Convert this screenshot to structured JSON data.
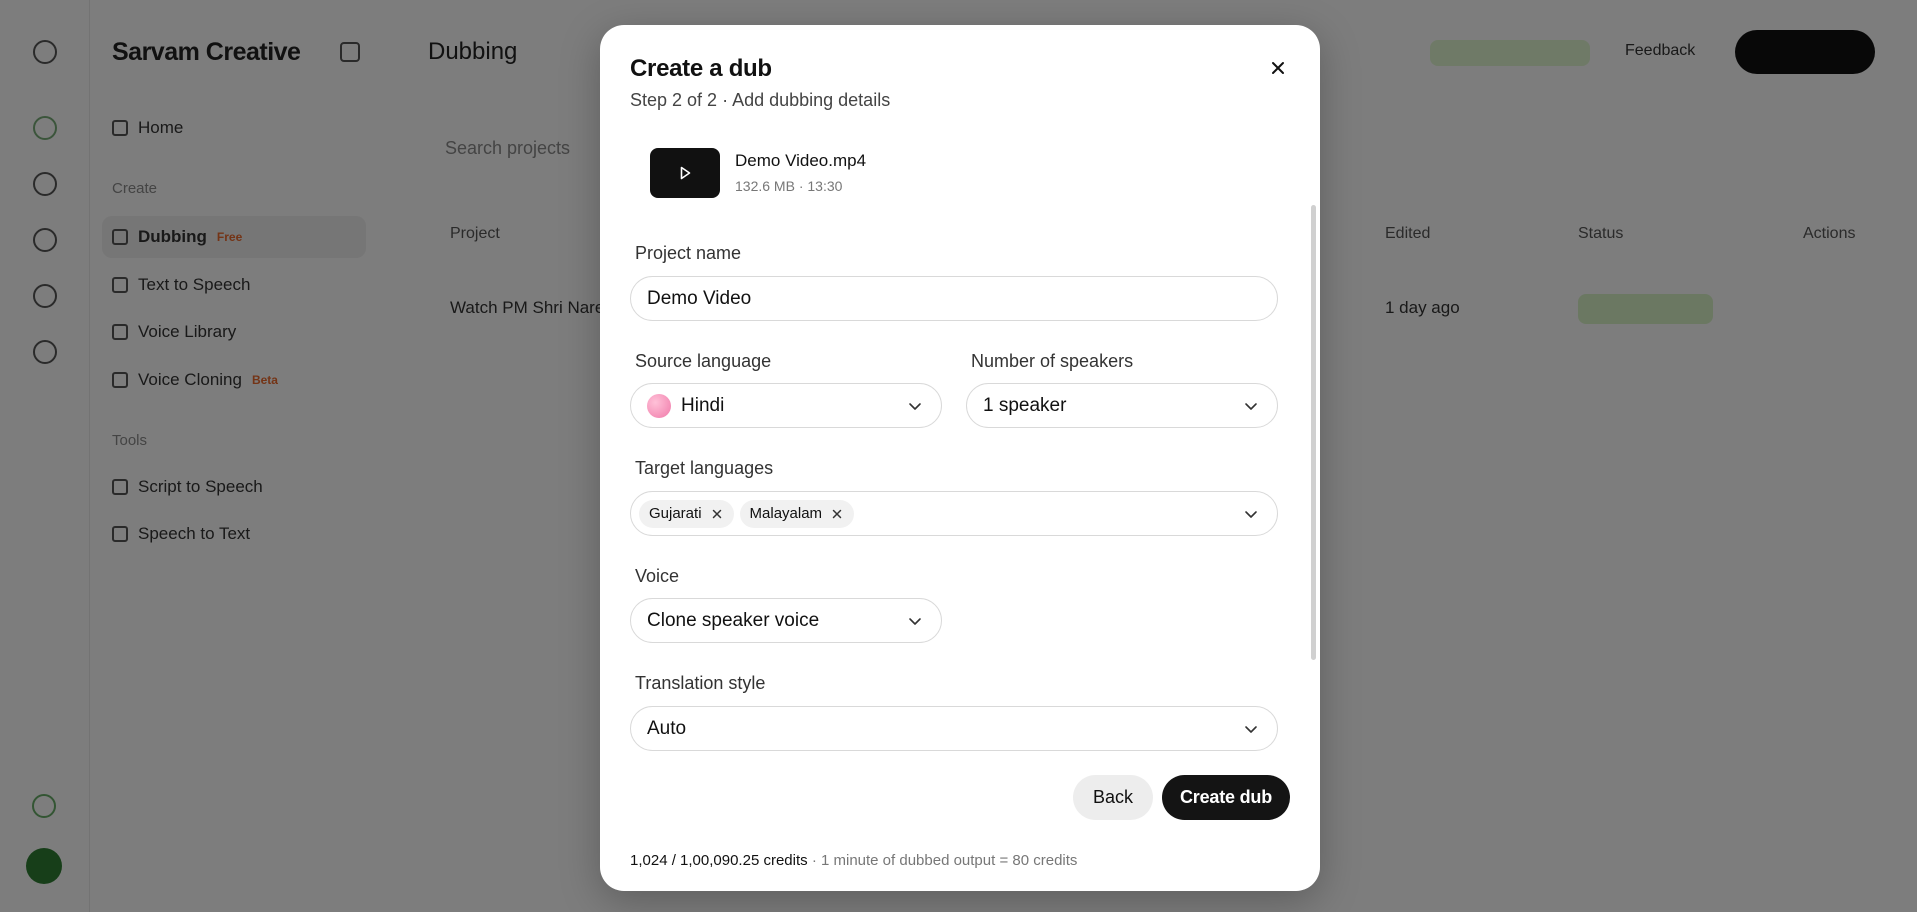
{
  "background": {
    "brand": "Sarvam Creative",
    "page_title": "Dubbing",
    "nav": [
      {
        "label": "Home"
      },
      {
        "section": "Create"
      },
      {
        "label": "Dubbing",
        "tag": "Free"
      },
      {
        "label": "Text to Speech"
      },
      {
        "label": "Voice Library"
      },
      {
        "label": "Voice Cloning",
        "tag": "Beta"
      },
      {
        "section": "Tools"
      },
      {
        "label": "Script to Speech"
      },
      {
        "label": "Speech to Text"
      }
    ],
    "feedback": "Feedback",
    "search_placeholder": "Search projects",
    "table_headers": [
      "Project",
      "Edited",
      "Status",
      "Actions"
    ],
    "row": {
      "project": "Watch PM Shri Nare...",
      "edited": "1 day ago"
    }
  },
  "modal": {
    "title": "Create a dub",
    "step": "Step 2 of 2 · Add dubbing details",
    "file": {
      "name": "Demo Video.mp4",
      "meta": "132.6 MB · 13:30"
    },
    "project_name": {
      "label": "Project name",
      "value": "Demo Video"
    },
    "source_language": {
      "label": "Source language",
      "value": "Hindi"
    },
    "speakers": {
      "label": "Number of speakers",
      "value": "1 speaker"
    },
    "target_languages": {
      "label": "Target languages",
      "chips": [
        "Gujarati",
        "Malayalam"
      ]
    },
    "voice": {
      "label": "Voice",
      "value": "Clone speaker voice"
    },
    "translation_style": {
      "label": "Translation style",
      "value": "Auto"
    },
    "back_label": "Back",
    "create_label": "Create dub",
    "credits": "1,024 / 1,00,090.25 credits",
    "separator": "·",
    "credit_rate": "1 minute of dubbed output = 80 credits"
  }
}
